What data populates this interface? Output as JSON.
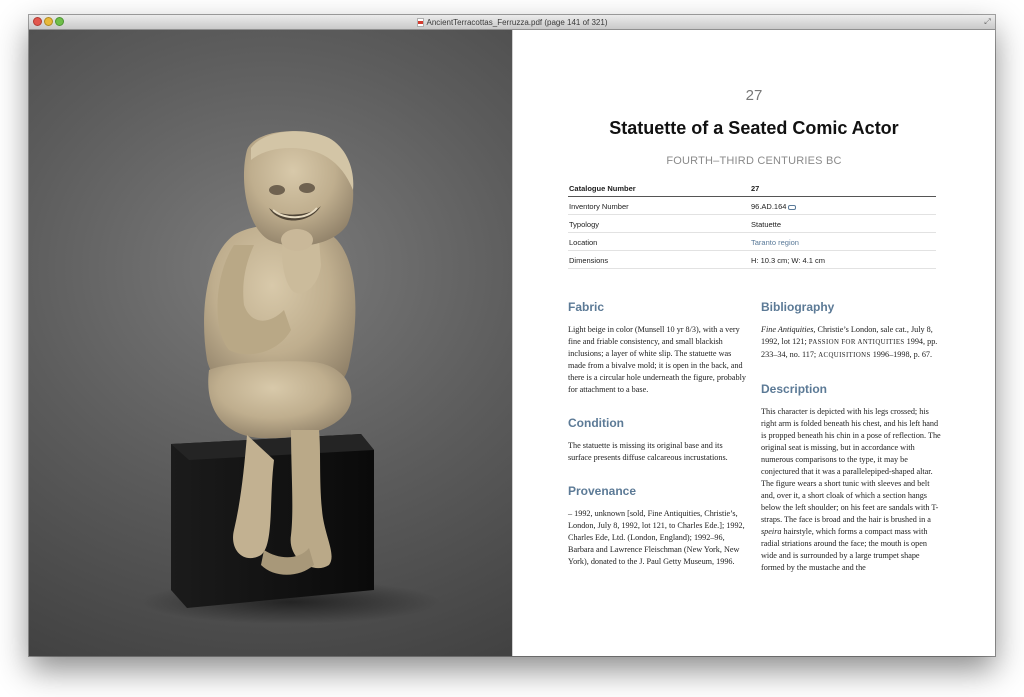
{
  "window": {
    "title": "AncientTerracottas_Ferruzza.pdf (page 141 of 321)",
    "icons": {
      "close": "close-light",
      "minimize": "minimize-light",
      "zoom": "zoom-light",
      "doc": "pdf-doc-icon",
      "fullscreen": "fullscreen-arrows-icon"
    }
  },
  "photo": {
    "subject": "terracotta statuette of seated comic actor on black base",
    "colors": {
      "background": "#5c5c5c",
      "clay": "#c9b899",
      "base": "#161616"
    }
  },
  "entry": {
    "number": "27",
    "title": "Statuette of a Seated Comic Actor",
    "date": "FOURTH–THIRD CENTURIES BC"
  },
  "metadata": [
    {
      "label": "Catalogue Number",
      "value": "27"
    },
    {
      "label": "Inventory Number",
      "value": "96.AD.164"
    },
    {
      "label": "Typology",
      "value": "Statuette"
    },
    {
      "label": "Location",
      "value": "Taranto region"
    },
    {
      "label": "Dimensions",
      "value": "H: 10.3 cm; W: 4.1 cm"
    }
  ],
  "sections": {
    "fabric": {
      "heading": "Fabric",
      "text": "Light beige in color (Munsell 10 yr 8/3), with a very fine and friable consistency, and small blackish inclusions; a layer of white slip. The statuette was made from a bivalve mold; it is open in the back, and there is a circular hole underneath the figure, probably for attachment to a base."
    },
    "condition": {
      "heading": "Condition",
      "text": "The statuette is missing its original base and its surface presents diffuse calcareous incrustations."
    },
    "provenance": {
      "heading": "Provenance",
      "text": "– 1992, unknown [sold, Fine Antiquities, Christie’s, London, July 8, 1992, lot 121, to Charles Ede.]; 1992, Charles Ede, Ltd. (London, England); 1992–96, Barbara and Lawrence Fleischman (New York, New York), donated to the J. Paul Getty Museum, 1996."
    },
    "bibliography": {
      "heading": "Bibliography",
      "title1": "Fine Antiquities",
      "text1": ", Christie’s London, sale cat., July 8, 1992, lot 121; ",
      "title2": "Passion for Antiquities",
      "text2": " 1994, pp. 233–34, no. 117; ",
      "title3": "Acquisitions",
      "text3": " 1996–1998, p. 67."
    },
    "description": {
      "heading": "Description",
      "text_before": "This character is depicted with his legs crossed; his right arm is folded beneath his chest, and his left hand is propped beneath his chin in a pose of reflection. The original seat is missing, but in accordance with numerous comparisons to the type, it may be conjectured that it was a parallelepiped-shaped altar. The figure wears a short tunic with sleeves and belt and, over it, a short cloak of which a section hangs below the left shoulder; on his feet are sandals with T-straps. The face is broad and the hair is brushed in a ",
      "italic_word": "speira",
      "text_after": " hairstyle, which forms a compact mass with radial striations around the face; the mouth is open wide and is surrounded by a large trumpet shape formed by the mustache and the"
    }
  }
}
